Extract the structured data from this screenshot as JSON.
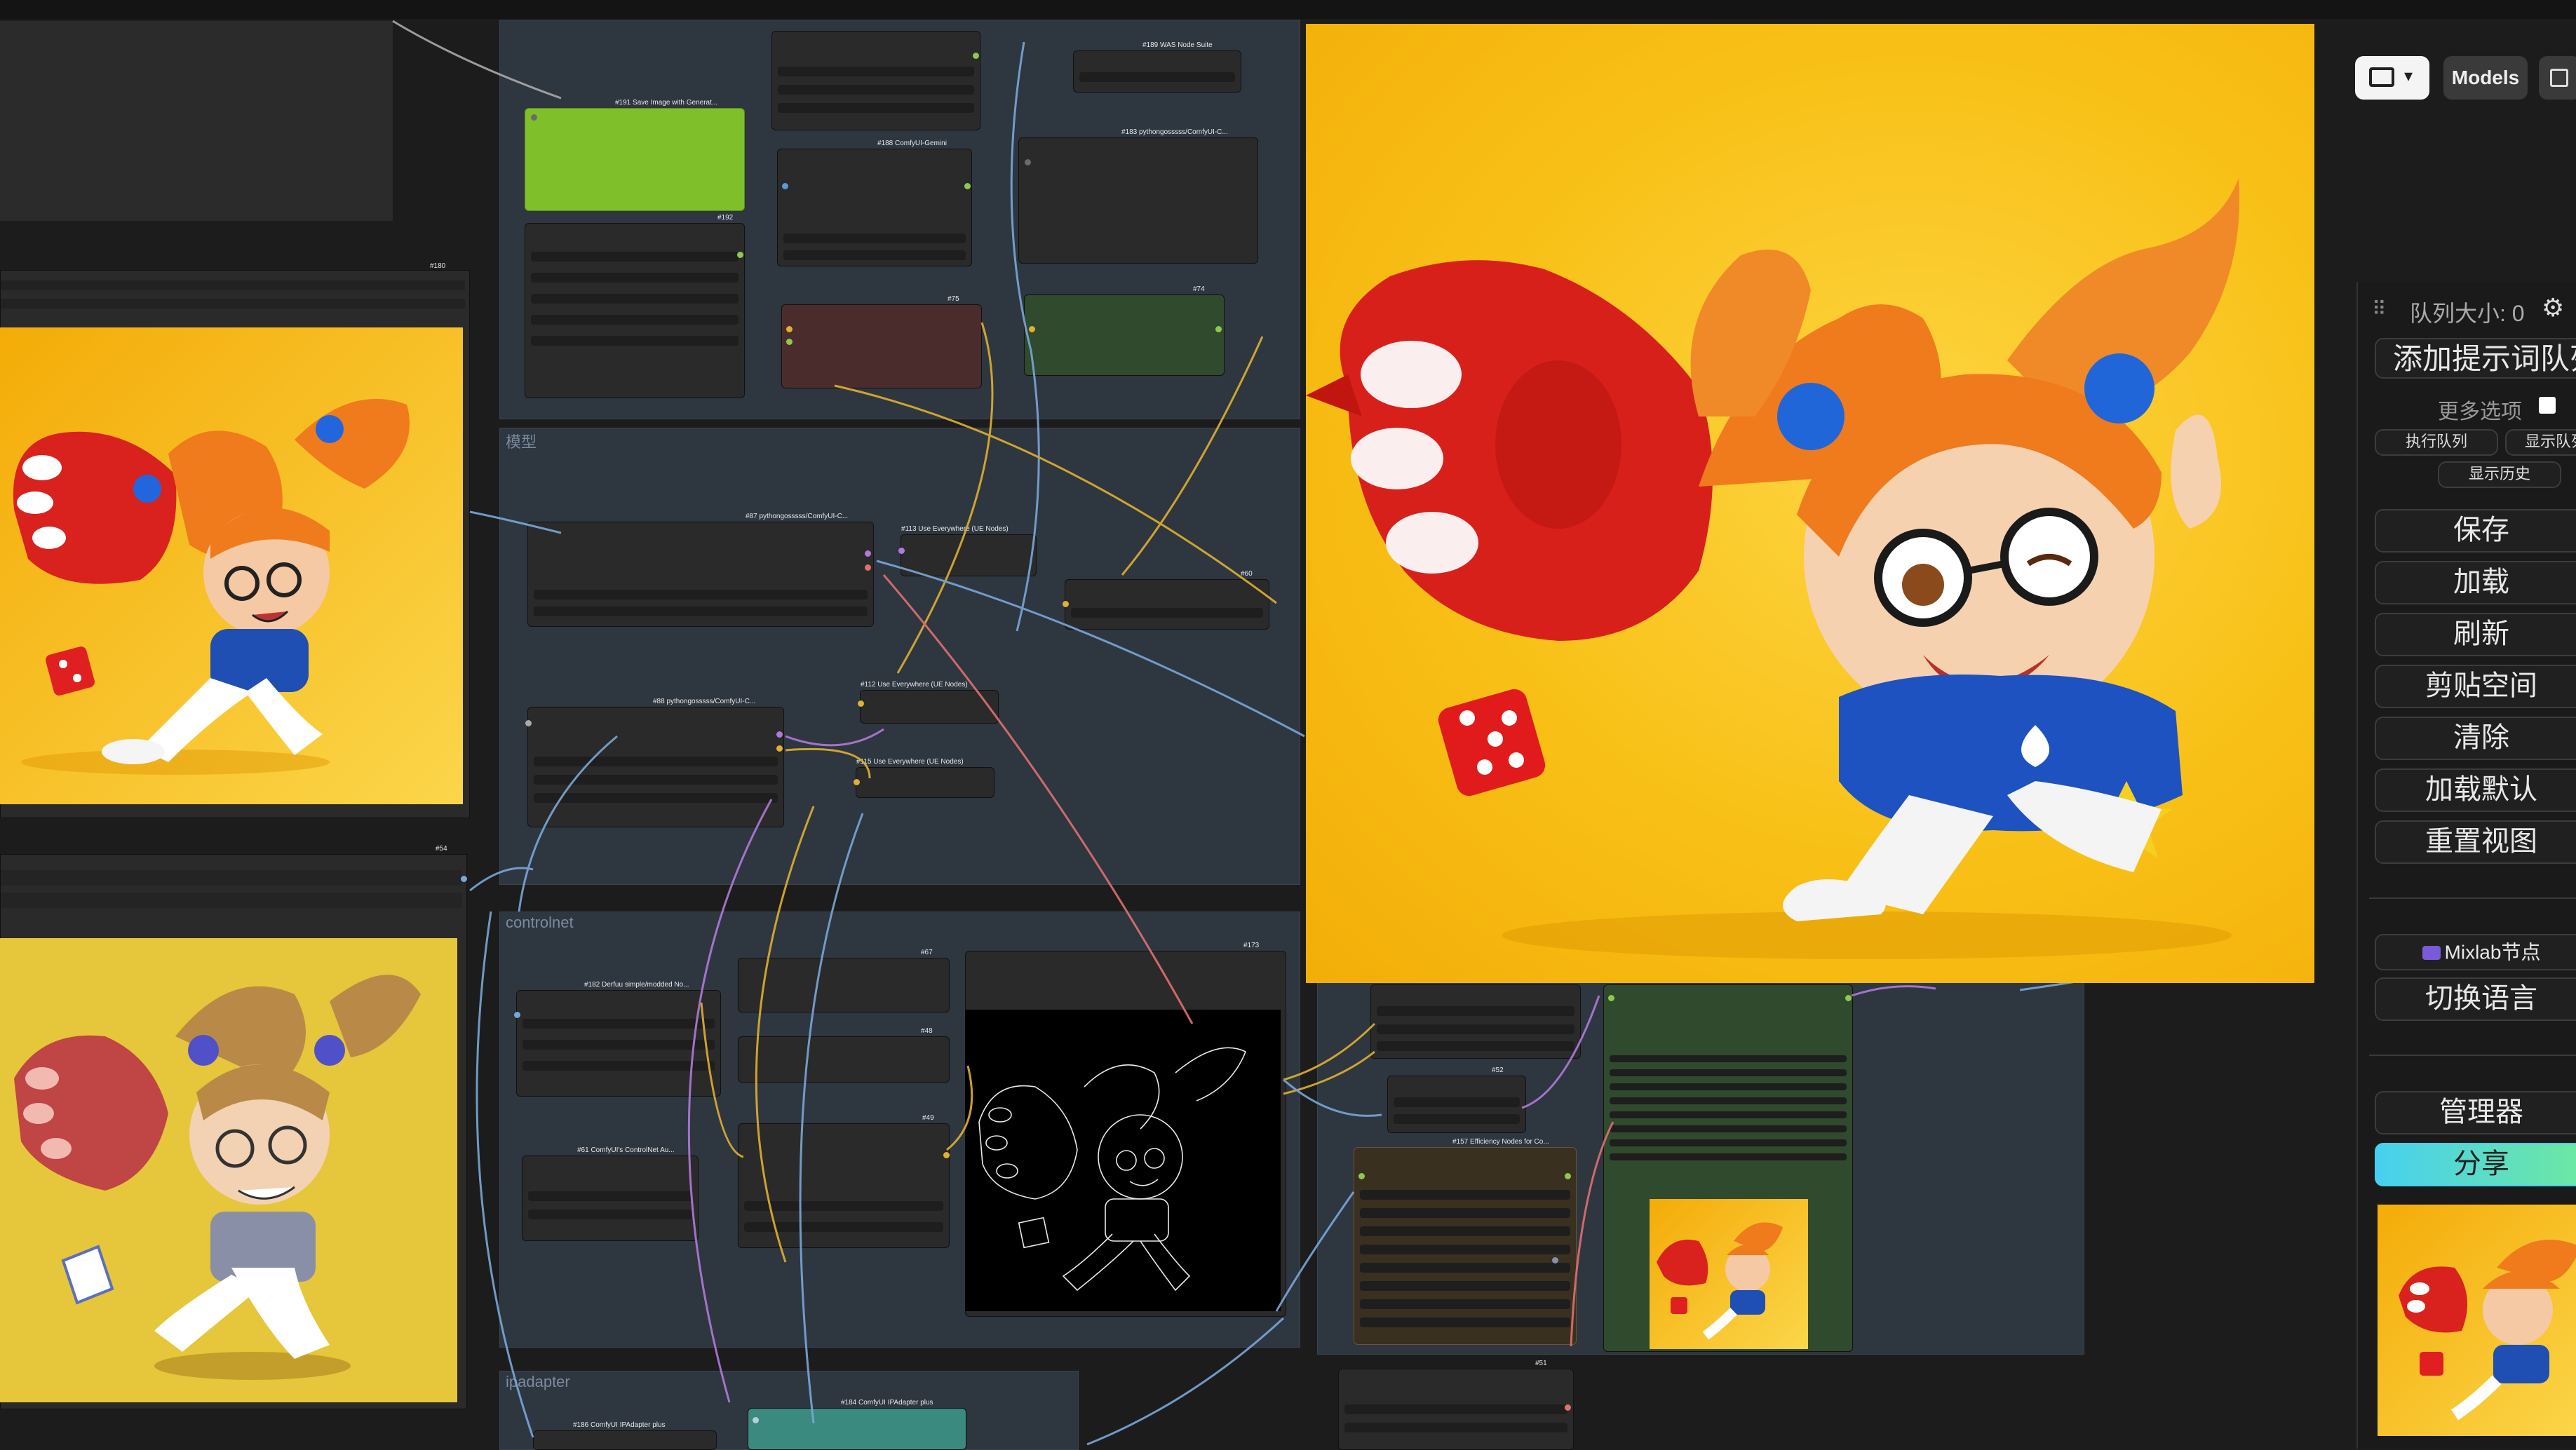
{
  "canvas": {
    "groups": [
      {
        "id": "g-top",
        "title": ""
      },
      {
        "id": "g-model",
        "title": "模型"
      },
      {
        "id": "g-controlnet",
        "title": "controlnet"
      },
      {
        "id": "g-ipadapter",
        "title": "ipadapter"
      }
    ],
    "nodes": {
      "n191": "#191 Save Image with Generat...",
      "n192": "#192",
      "n188": "#188 ComfyUI-Gemini",
      "n189": "#189 WAS Node Suite",
      "n183": "#183 pythongosssss/ComfyUI-C...",
      "n75": "#75",
      "n74": "#74",
      "n180": "#180",
      "n87": "#87 pythongosssss/ComfyUI-C...",
      "n113": "#113 Use Everywhere (UE Nodes)",
      "n60": "#60",
      "n88": "#88 pythongosssss/ComfyUI-C...",
      "n112": "#112 Use Everywhere (UE Nodes)",
      "n115": "#115 Use Everywhere (UE Nodes)",
      "n54": "#54",
      "n182": "#182 Derfuu simple/modded No...",
      "n67": "#67",
      "n173": "#173",
      "n48": "#48",
      "n61": "#61 ComfyUI's ControlNet Au...",
      "n49": "#49",
      "n52": "#52",
      "n157": "#157 Efficiency Nodes for Co...",
      "n51": "#51",
      "n186": "#186 ComfyUI IPAdapter plus",
      "n184": "#184 ComfyUI IPAdapter plus"
    }
  },
  "toolbar": {
    "folder_icon": "folder-icon",
    "models_label": "Models",
    "save_icon": "floppy-icon"
  },
  "queue_panel": {
    "queue_size_label": "队列大小: 0",
    "add_prompt_label": "添加提示词队列",
    "more_options_label": "更多选项",
    "run_queue_label": "执行队列",
    "show_queue_label": "显示队列",
    "show_history_label": "显示历史",
    "save_label": "保存",
    "load_label": "加载",
    "refresh_label": "刷新",
    "clipspace_label": "剪贴空间",
    "clear_label": "清除",
    "load_default_label": "加载默认",
    "reset_view_label": "重置视图",
    "mixlab_label": "Mixlab节点",
    "switch_lang_label": "切换语言",
    "manager_label": "管理器",
    "share_label": "分享"
  },
  "colors": {
    "canvas_bg": "#1c1c1c",
    "group_bg": "#2e3640",
    "preview_yellow": "#f7b90f",
    "lime_node": "#7fbf2a",
    "share_gradient_start": "#46d0f0",
    "share_gradient_end": "#6ee8a0"
  }
}
